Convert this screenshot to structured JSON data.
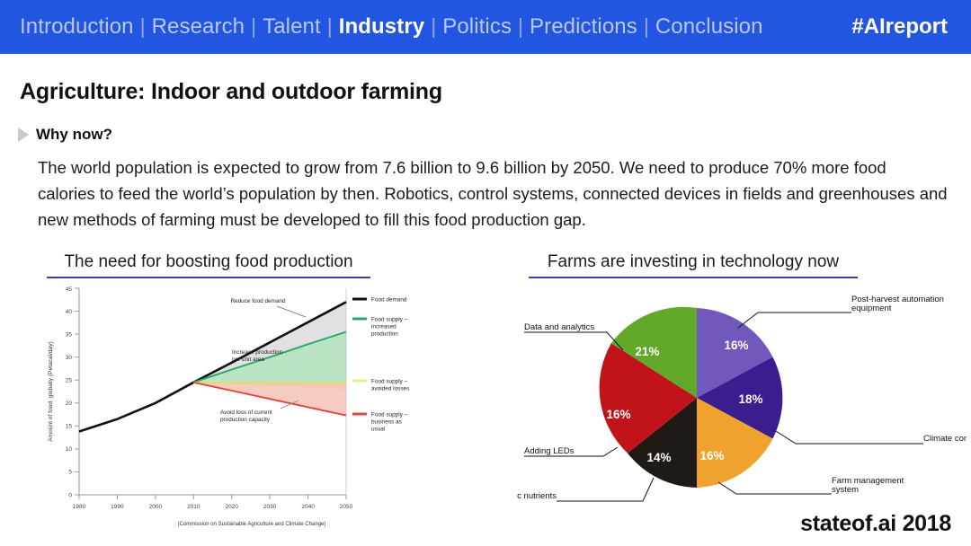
{
  "nav": {
    "items": [
      {
        "label": "Introduction",
        "active": false
      },
      {
        "label": "Research",
        "active": false
      },
      {
        "label": "Talent",
        "active": false
      },
      {
        "label": "Industry",
        "active": true
      },
      {
        "label": "Politics",
        "active": false
      },
      {
        "label": "Predictions",
        "active": false
      },
      {
        "label": "Conclusion",
        "active": false
      }
    ],
    "separator": "|",
    "hashtag": "#AIreport",
    "background_color": "#2255e0",
    "active_color": "#ffffff",
    "inactive_color": "#b9c9f5"
  },
  "slide": {
    "title": "Agriculture: Indoor and outdoor farming",
    "section_label": "Why now?",
    "body": "The world population is expected to grow from 7.6 billion to 9.6 billion by 2050. We need to produce 70% more food calories to feed the world’s population by then. Robotics, control systems, connected devices in fields and greenhouses and new methods of farming must be developed to fill this food production gap.",
    "brand": "stateof.ai 2018",
    "accent_color": "#3b3f9e"
  },
  "chart_data": [
    {
      "type": "area",
      "title": "The need for boosting food production",
      "xlabel": "",
      "ylabel": "Amount of food, globally (Petacal/day)",
      "xlim": [
        1980,
        2050
      ],
      "ylim": [
        0,
        45
      ],
      "xticks": [
        "1980",
        "1990",
        "2000",
        "2010",
        "2020",
        "2030",
        "2040",
        "2050"
      ],
      "yticks": [
        "0",
        "5",
        "10",
        "15",
        "20",
        "25",
        "30",
        "35",
        "40",
        "45"
      ],
      "grid": false,
      "caption": "(Commission on Sustainable Agriculture and Climate Change)",
      "x": [
        1980,
        1990,
        2000,
        2010,
        2020,
        2030,
        2040,
        2050
      ],
      "series": [
        {
          "name": "Food demand",
          "color": "#111111",
          "values": [
            13.8,
            16.5,
            20.0,
            24.5,
            28.8,
            33.2,
            37.6,
            42.0
          ]
        },
        {
          "name": "Food supply – increased production",
          "color": "#2aa86b",
          "values": [
            13.8,
            16.5,
            20.0,
            24.5,
            27.3,
            30.0,
            32.8,
            35.5
          ]
        },
        {
          "name": "Food supply – avoided losses",
          "color": "#e7ef8a",
          "values": [
            13.8,
            16.5,
            20.0,
            24.5,
            24.5,
            24.5,
            24.5,
            24.5
          ]
        },
        {
          "name": "Food supply – business as usual",
          "color": "#e0453a",
          "values": [
            13.8,
            16.5,
            20.0,
            24.5,
            22.7,
            20.9,
            19.1,
            17.3
          ]
        }
      ],
      "annotations": [
        "Reduce food demand",
        "Increase production per unit area",
        "Avoid loss of current production capacity"
      ]
    },
    {
      "type": "pie",
      "title": "Farms are investing in technology now",
      "legend_position": "callouts",
      "categories": [
        "Post-harvest automation equipment",
        "Climate control system",
        "Farm management system",
        "Organic nutrients",
        "Adding LEDs",
        "Data and analytics"
      ],
      "values": [
        16,
        18,
        16,
        14,
        16,
        21
      ],
      "value_labels": [
        "16%",
        "18%",
        "16%",
        "14%",
        "16%",
        "21%"
      ],
      "colors": [
        "#7158bd",
        "#3a1d8f",
        "#f0a22e",
        "#201a17",
        "#c1141a",
        "#62a82a"
      ]
    }
  ]
}
